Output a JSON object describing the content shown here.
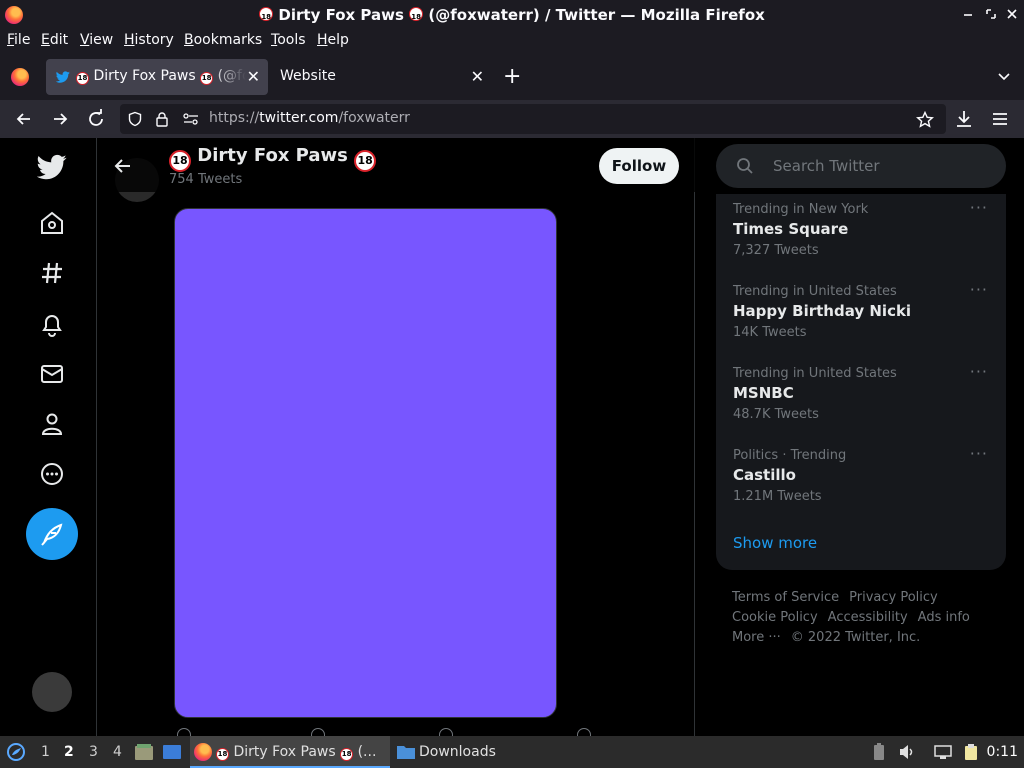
{
  "window": {
    "title": "🔞 Dirty Fox Paws 🔞 (@foxwaterr) / Twitter — Mozilla Firefox",
    "title_prefix": "Dirty Fox Paws",
    "title_suffix": "(@foxwaterr) / Twitter — Mozilla Firefox",
    "badge": "18"
  },
  "menu": {
    "file": "File",
    "edit": "Edit",
    "view": "View",
    "history": "History",
    "bookmarks": "Bookmarks",
    "tools": "Tools",
    "help": "Help"
  },
  "tabs": [
    {
      "label": "Dirty Fox Paws",
      "label_rest": "(@foxwaterr) / Twitter",
      "badge": "18",
      "active": true
    },
    {
      "label": "Website",
      "active": false
    }
  ],
  "urlbar": {
    "scheme": "https://",
    "host": "twitter.com",
    "path": "/foxwaterr"
  },
  "profile": {
    "name": "Dirty Fox Paws",
    "badge": "18",
    "tweet_count": "754 Tweets",
    "follow_label": "Follow"
  },
  "media": {
    "color": "#7856ff"
  },
  "search": {
    "placeholder": "Search Twitter"
  },
  "trends": [
    {
      "context": "Trending in New York",
      "name": "Times Square",
      "count": "7,327 Tweets"
    },
    {
      "context": "Trending in United States",
      "name": "Happy Birthday Nicki",
      "count": "14K Tweets"
    },
    {
      "context": "Trending in United States",
      "name": "MSNBC",
      "count": "48.7K Tweets"
    },
    {
      "context": "Politics · Trending",
      "name": "Castillo",
      "count": "1.21M Tweets"
    }
  ],
  "show_more": "Show more",
  "footer": {
    "terms": "Terms of Service",
    "privacy": "Privacy Policy",
    "cookie": "Cookie Policy",
    "accessibility": "Accessibility",
    "ads": "Ads info",
    "more": "More ···",
    "copyright": "© 2022 Twitter, Inc."
  },
  "taskbar": {
    "workspaces": [
      "1",
      "2",
      "3",
      "4"
    ],
    "current_workspace": "2",
    "firefox_task": "Dirty Fox Paws",
    "firefox_task_badge": "18",
    "firefox_task_suffix": "(...",
    "downloads_task": "Downloads",
    "clock": "0:11"
  },
  "colors": {
    "accent": "#1d9bf0",
    "chrome_bg": "#1c1b22",
    "page_bg": "#000000"
  }
}
